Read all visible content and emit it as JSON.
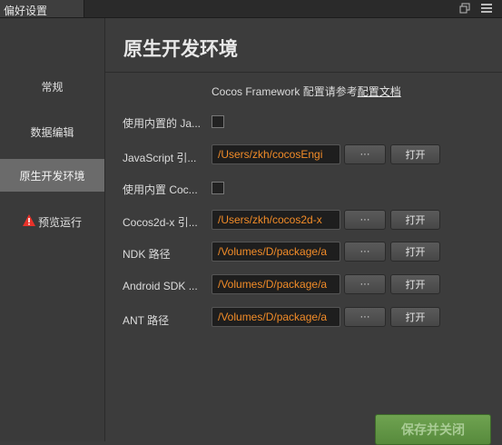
{
  "window": {
    "tab_title": "偏好设置"
  },
  "sidebar": {
    "items": [
      {
        "label": "常规"
      },
      {
        "label": "数据编辑"
      },
      {
        "label": "原生开发环境"
      },
      {
        "label": "预览运行"
      }
    ],
    "active_index": 2
  },
  "main": {
    "title": "原生开发环境",
    "notice_text": "Cocos Framework 配置请参考",
    "notice_link": "配置文档",
    "rows": [
      {
        "label": "使用内置的 Ja..."
      },
      {
        "label": "JavaScript 引...",
        "path": "/Users/zkh/cocosEngi"
      },
      {
        "label": "使用内置 Coc..."
      },
      {
        "label": "Cocos2d-x 引...",
        "path": "/Users/zkh/cocos2d-x"
      },
      {
        "label": "NDK 路径",
        "path": "/Volumes/D/package/a"
      },
      {
        "label": "Android SDK ...",
        "path": "/Volumes/D/package/a"
      },
      {
        "label": "ANT 路径",
        "path": "/Volumes/D/package/a"
      }
    ],
    "browse_label": "···",
    "open_label": "打开",
    "save_label": "保存并关闭"
  },
  "colors": {
    "path_text": "#f28c28",
    "save_button": "#6fa351",
    "warning_icon": "#e8322a"
  },
  "icons": [
    "restore-window-icon",
    "menu-icon",
    "warning-icon"
  ]
}
